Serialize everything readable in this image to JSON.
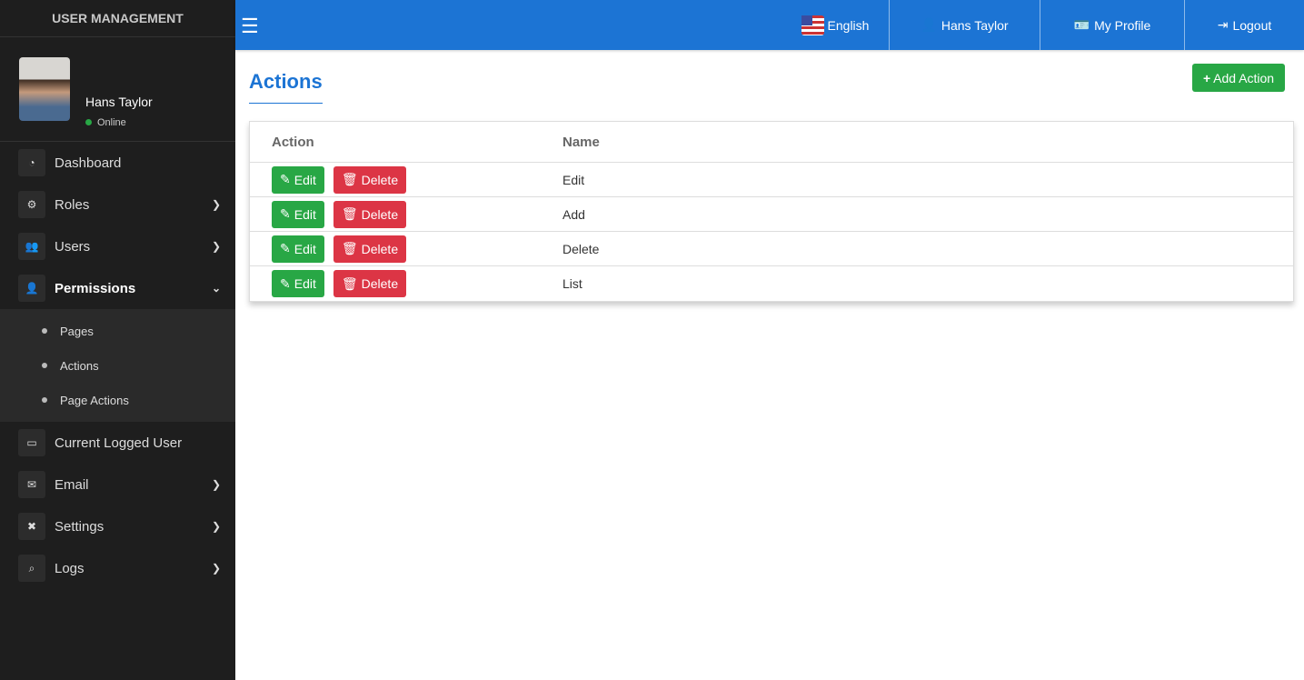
{
  "sidebar": {
    "brand": "USER MANAGEMENT",
    "user": {
      "name": "Hans Taylor",
      "status": "Online"
    },
    "items": [
      {
        "label": "Dashboard"
      },
      {
        "label": "Roles"
      },
      {
        "label": "Users"
      },
      {
        "label": "Permissions"
      },
      {
        "label": "Current Logged User"
      },
      {
        "label": "Email"
      },
      {
        "label": "Settings"
      },
      {
        "label": "Logs"
      }
    ],
    "subitems": [
      {
        "label": "Pages"
      },
      {
        "label": "Actions"
      },
      {
        "label": "Page Actions"
      }
    ]
  },
  "topbar": {
    "language": "English",
    "user": "Hans Taylor",
    "profile": "My Profile",
    "logout": "Logout"
  },
  "page": {
    "title": "Actions",
    "add_label": "Add Action"
  },
  "table": {
    "headers": [
      "Action",
      "Name"
    ],
    "edit_label": "Edit",
    "delete_label": "Delete",
    "rows": [
      {
        "name": "Edit"
      },
      {
        "name": "Add"
      },
      {
        "name": "Delete"
      },
      {
        "name": "List"
      }
    ]
  }
}
